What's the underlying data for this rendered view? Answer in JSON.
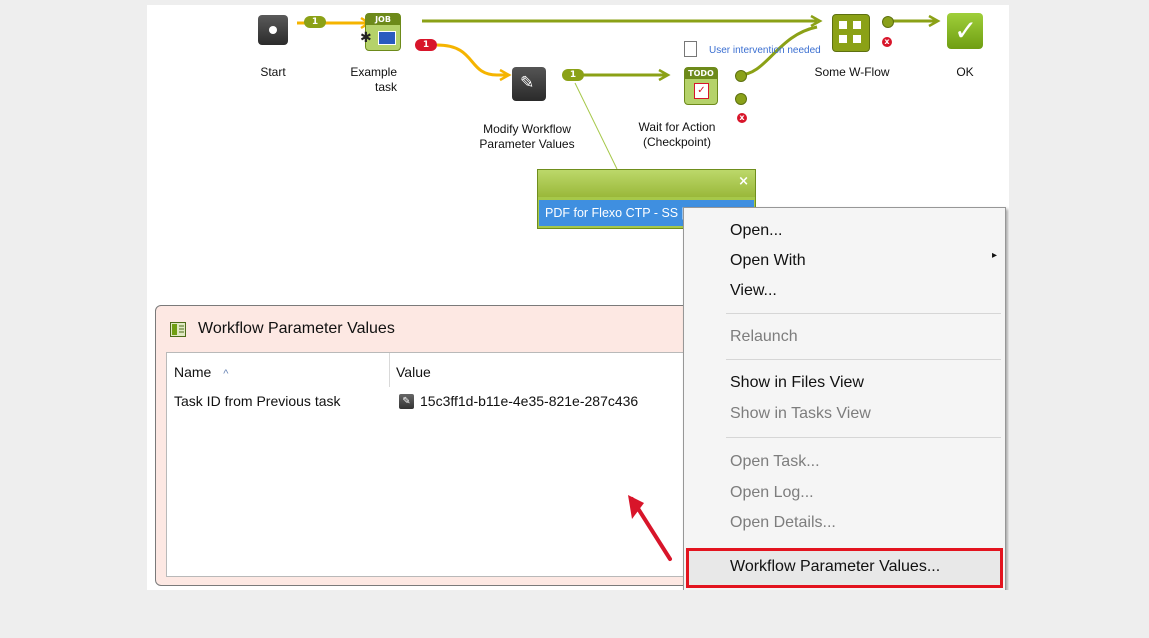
{
  "workflow": {
    "nodes": {
      "start": "Start",
      "example_task": "Example\ntask",
      "modify": "Modify Workflow\nParameter Values",
      "wait": "Wait for Action\n(Checkpoint)",
      "sub_flow": "Some W-Flow",
      "ok": "OK"
    },
    "badges": {
      "job": "JOB",
      "todo": "TODO",
      "count_1a": "1",
      "count_1b": "1",
      "count_red": "1"
    },
    "user_intervention": "User intervention needed",
    "colors": {
      "flow_green": "#8ba116",
      "flow_orange": "#f5b400",
      "error_red": "#d8152a"
    }
  },
  "popup": {
    "row_text": "PDF for Flexo CTP - SS [wip]",
    "close": "×"
  },
  "panel": {
    "title": "Workflow Parameter Values",
    "columns": [
      "Name",
      "Value"
    ],
    "sort_icon": "^",
    "rows": [
      {
        "name": "Task ID from Previous task",
        "value": "15c3ff1d-b11e-4e35-821e-287c436"
      }
    ]
  },
  "menu": {
    "items": [
      {
        "label": "Open...",
        "enabled": true
      },
      {
        "label": "Open With",
        "enabled": true,
        "submenu": true
      },
      {
        "label": "View...",
        "enabled": true
      },
      {
        "label": "Relaunch",
        "enabled": false
      },
      {
        "label": "Show in Files View",
        "enabled": true
      },
      {
        "label": "Show in Tasks View",
        "enabled": false
      },
      {
        "label": "Open Task...",
        "enabled": false
      },
      {
        "label": "Open Log...",
        "enabled": false
      },
      {
        "label": "Open Details...",
        "enabled": false
      },
      {
        "label": "Workflow Parameter Values...",
        "enabled": true,
        "highlighted": true
      }
    ]
  }
}
